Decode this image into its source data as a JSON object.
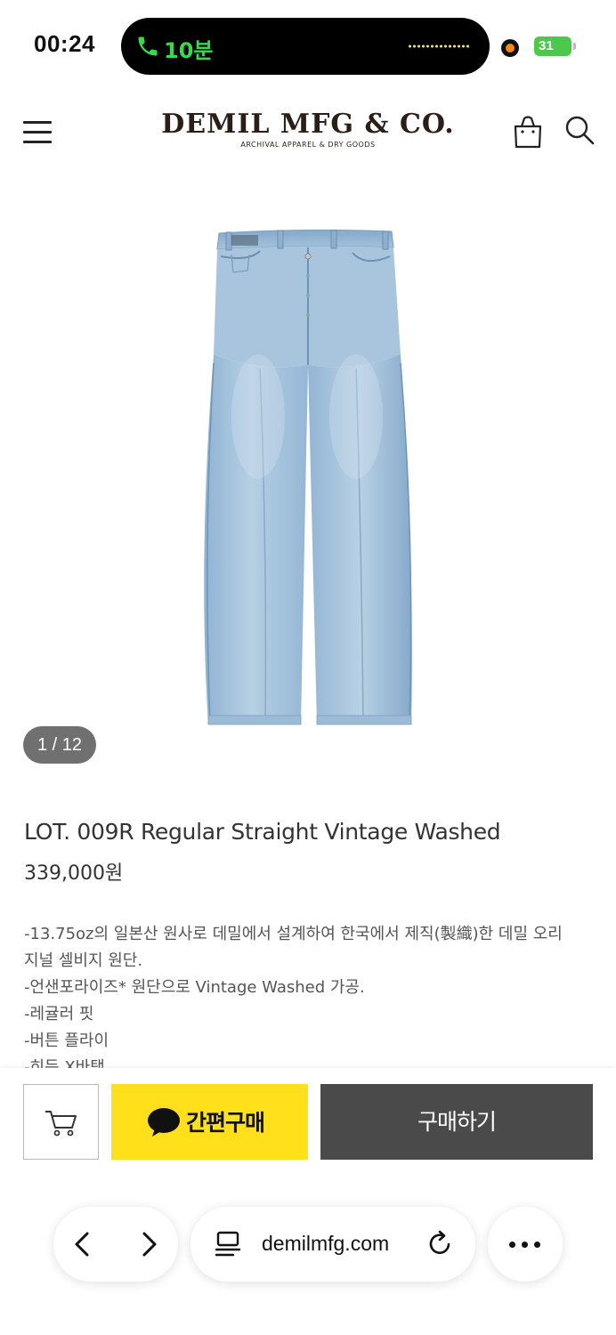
{
  "status_bar": {
    "time": "00:24",
    "call_duration": "10분",
    "battery": "31"
  },
  "header": {
    "logo": "DEMIL MFG & CO.",
    "logo_tagline": "ARCHIVAL APPAREL & DRY GOODS"
  },
  "gallery": {
    "pager": "1 / 12"
  },
  "product": {
    "title": "LOT. 009R Regular Straight Vintage Washed",
    "price": "339,000원",
    "description": [
      "-13.75oz의 일본산 원사로 데밀에서 설계하여 한국에서 제직(製織)한 데밀 오리",
      "지널 셀비지 원단.",
      "-언샌포라이즈* 원단으로  Vintage Washed 가공.",
      "-레귤러 핏",
      "-버튼 플라이",
      "-히든 X바택"
    ]
  },
  "purchase_bar": {
    "kakao_label": "간편구매",
    "buy_label": "구매하기"
  },
  "browser": {
    "url": "demilmfg.com"
  },
  "colors": {
    "kakao_yellow": "#ffe01b",
    "buy_button": "#4a4a4a",
    "call_green": "#38d94c",
    "battery_green": "#4cc94b",
    "logo_brown": "#2b1e16"
  },
  "icons": [
    "phone-icon",
    "menu-icon",
    "bag-icon",
    "search-icon",
    "cart-icon",
    "chat-bubble-icon",
    "back-icon",
    "forward-icon",
    "reader-icon",
    "reload-icon",
    "more-icon"
  ]
}
